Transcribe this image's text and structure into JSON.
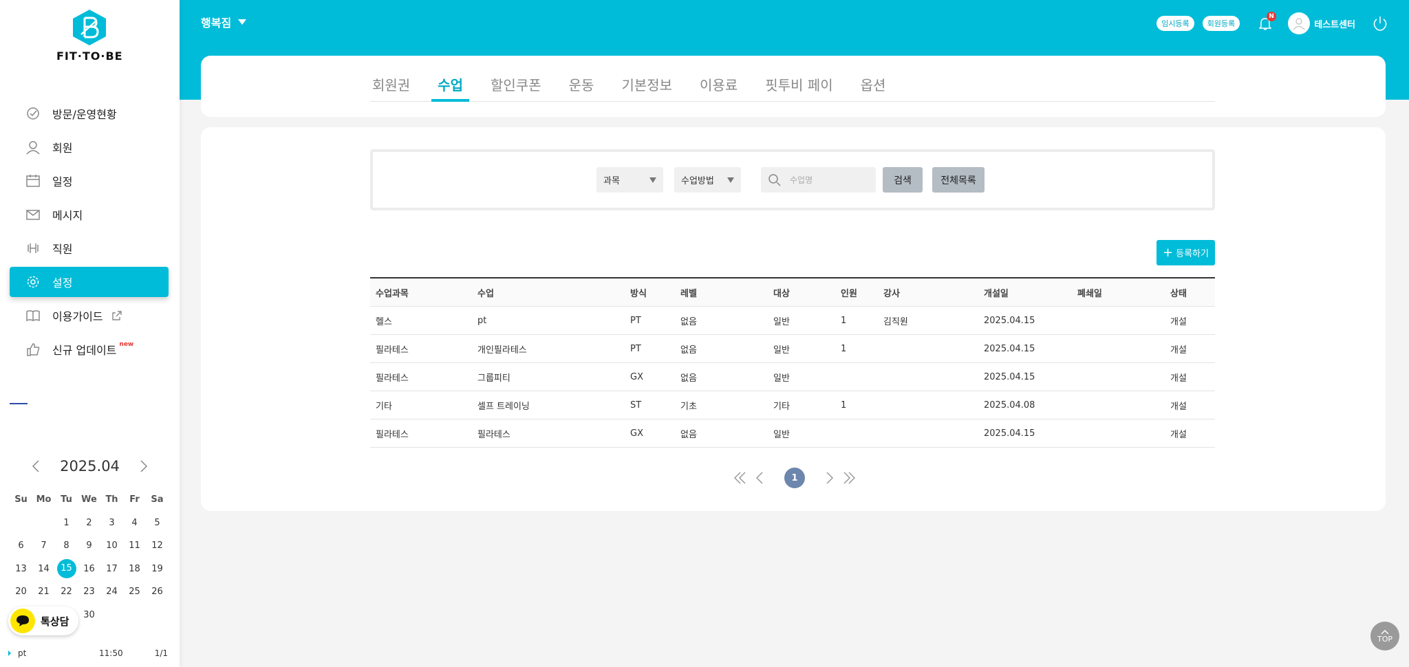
{
  "brand": {
    "logo_text": "FIT·TO·BE"
  },
  "header": {
    "gym_name": "행복짐",
    "temp_register": "임시등록",
    "member_register": "회원등록",
    "notification_badge": "N",
    "user_name": "테스트센터"
  },
  "sidebar": {
    "items": [
      {
        "label": "방문/운영현황",
        "icon": "checkmark-badge-icon"
      },
      {
        "label": "회원",
        "icon": "person-icon"
      },
      {
        "label": "일정",
        "icon": "calendar-icon"
      },
      {
        "label": "메시지",
        "icon": "envelope-icon"
      },
      {
        "label": "직원",
        "icon": "dumbbell-icon"
      },
      {
        "label": "설정",
        "icon": "gear-icon",
        "active": true
      },
      {
        "label": "이용가이드",
        "icon": "book-icon"
      },
      {
        "label": "신규 업데이트",
        "icon": "thumbs-up-icon",
        "badge": "new"
      }
    ]
  },
  "calendar": {
    "title": "2025.04",
    "weekdays": [
      "Su",
      "Mo",
      "Tu",
      "We",
      "Th",
      "Fr",
      "Sa"
    ],
    "weeks": [
      [
        "",
        "",
        "1",
        "2",
        "3",
        "4",
        "5"
      ],
      [
        "6",
        "7",
        "8",
        "9",
        "10",
        "11",
        "12"
      ],
      [
        "13",
        "14",
        "15",
        "16",
        "17",
        "18",
        "19"
      ],
      [
        "20",
        "21",
        "22",
        "23",
        "24",
        "25",
        "26"
      ],
      [
        "",
        "",
        "",
        "30",
        "",
        "",
        ""
      ]
    ],
    "today": "15"
  },
  "chat": {
    "label": "톡상담"
  },
  "schedule": {
    "title": "pt",
    "time": "11:50",
    "count": "1/1"
  },
  "tabs": [
    {
      "label": "회원권"
    },
    {
      "label": "수업",
      "active": true
    },
    {
      "label": "할인쿠폰"
    },
    {
      "label": "운동"
    },
    {
      "label": "기본정보"
    },
    {
      "label": "이용료"
    },
    {
      "label": "핏투비 페이"
    },
    {
      "label": "옵션"
    }
  ],
  "search": {
    "subject_select": "과목",
    "method_select": "수업방법",
    "placeholder": "수업명",
    "search_button": "검색",
    "all_button": "전체목록"
  },
  "add_button": "등록하기",
  "table": {
    "columns": [
      "수업과목",
      "수업",
      "방식",
      "레벨",
      "대상",
      "인원",
      "강사",
      "개설일",
      "폐쇄일",
      "상태"
    ],
    "rows": [
      [
        "헬스",
        "pt",
        "PT",
        "없음",
        "일반",
        "1",
        "김직원",
        "2025.04.15",
        "",
        "개설"
      ],
      [
        "필라테스",
        "개인필라테스",
        "PT",
        "없음",
        "일반",
        "1",
        "",
        "2025.04.15",
        "",
        "개설"
      ],
      [
        "필라테스",
        "그룹피티",
        "GX",
        "없음",
        "일반",
        "",
        "",
        "2025.04.15",
        "",
        "개설"
      ],
      [
        "기타",
        "셀프 트레이닝",
        "ST",
        "기초",
        "기타",
        "1",
        "",
        "2025.04.08",
        "",
        "개설"
      ],
      [
        "필라테스",
        "필라테스",
        "GX",
        "없음",
        "일반",
        "",
        "",
        "2025.04.15",
        "",
        "개설"
      ]
    ]
  },
  "pagination": {
    "current": "1"
  },
  "top_button": "TOP",
  "colors": {
    "accent": "#00bcd9",
    "pager": "#6d86ad",
    "notification": "#e53935",
    "chat": "#fee500"
  }
}
